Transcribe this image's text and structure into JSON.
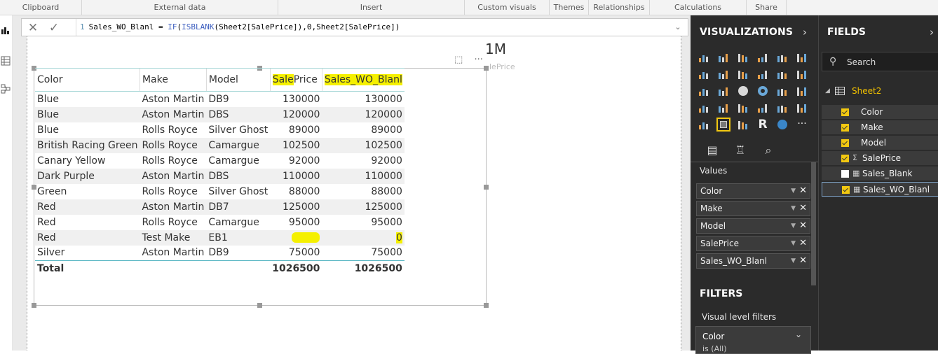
{
  "ribbon": {
    "groups": [
      "Clipboard",
      "External data",
      "Insert",
      "Custom visuals",
      "Themes",
      "Relationships",
      "Calculations",
      "Share"
    ]
  },
  "formula_bar": {
    "line_number": "1",
    "formula_prefix": "Sales_WO_Blanl = ",
    "formula_if": "IF",
    "formula_open": "(",
    "formula_isblank": "ISBLANK",
    "formula_rest": "(Sheet2[SalePrice]),0,Sheet2[SalePrice])"
  },
  "card": {
    "value": "1M",
    "label": "lePrice"
  },
  "table": {
    "headers": [
      "Color",
      "Make",
      "Model",
      "SalePrice",
      "Sales_WO_Blanl"
    ],
    "header_saleprice_hl": "Sale",
    "header_saleprice_rest": "Price",
    "rows": [
      [
        "Blue",
        "Aston Martin",
        "DB9",
        "130000",
        "130000"
      ],
      [
        "Blue",
        "Aston Martin",
        "DBS",
        "120000",
        "120000"
      ],
      [
        "Blue",
        "Rolls Royce",
        "Silver Ghost",
        "89000",
        "89000"
      ],
      [
        "British Racing Green",
        "Rolls Royce",
        "Camargue",
        "102500",
        "102500"
      ],
      [
        "Canary Yellow",
        "Rolls Royce",
        "Camargue",
        "92000",
        "92000"
      ],
      [
        "Dark Purple",
        "Aston Martin",
        "DBS",
        "110000",
        "110000"
      ],
      [
        "Green",
        "Rolls Royce",
        "Silver Ghost",
        "88000",
        "88000"
      ],
      [
        "Red",
        "Aston Martin",
        "DB7",
        "125000",
        "125000"
      ],
      [
        "Red",
        "Rolls Royce",
        "Camargue",
        "95000",
        "95000"
      ],
      [
        "Red",
        "Test Make",
        "EB1",
        "",
        "0"
      ],
      [
        "Silver",
        "Aston Martin",
        "DB9",
        "75000",
        "75000"
      ]
    ],
    "total": [
      "Total",
      "",
      "",
      "1026500",
      "1026500"
    ]
  },
  "visualizations": {
    "title": "VISUALIZATIONS",
    "values_label": "Values",
    "wells": [
      "Color",
      "Make",
      "Model",
      "SalePrice",
      "Sales_WO_Blanl"
    ],
    "filters_title": "FILTERS",
    "visual_level_filters": "Visual level filters",
    "filter_card": {
      "field": "Color",
      "state": "is (All)"
    },
    "r_icon": "R",
    "more_icon": "···"
  },
  "fields": {
    "title": "FIELDS",
    "search_placeholder": "Search",
    "table_name": "Sheet2",
    "items": [
      {
        "name": "Color",
        "checked": true,
        "symbol": ""
      },
      {
        "name": "Make",
        "checked": true,
        "symbol": ""
      },
      {
        "name": "Model",
        "checked": true,
        "symbol": ""
      },
      {
        "name": "SalePrice",
        "checked": true,
        "symbol": "Σ"
      },
      {
        "name": "Sales_Blank",
        "checked": false,
        "symbol": "▦"
      },
      {
        "name": "Sales_WO_Blanl",
        "checked": true,
        "symbol": "▦"
      }
    ]
  },
  "colors": {
    "highlight": "#f5f000",
    "pane_bg": "#2b2b2b",
    "accent": "#f2c811",
    "table_header_border": "#a5d6d6"
  }
}
